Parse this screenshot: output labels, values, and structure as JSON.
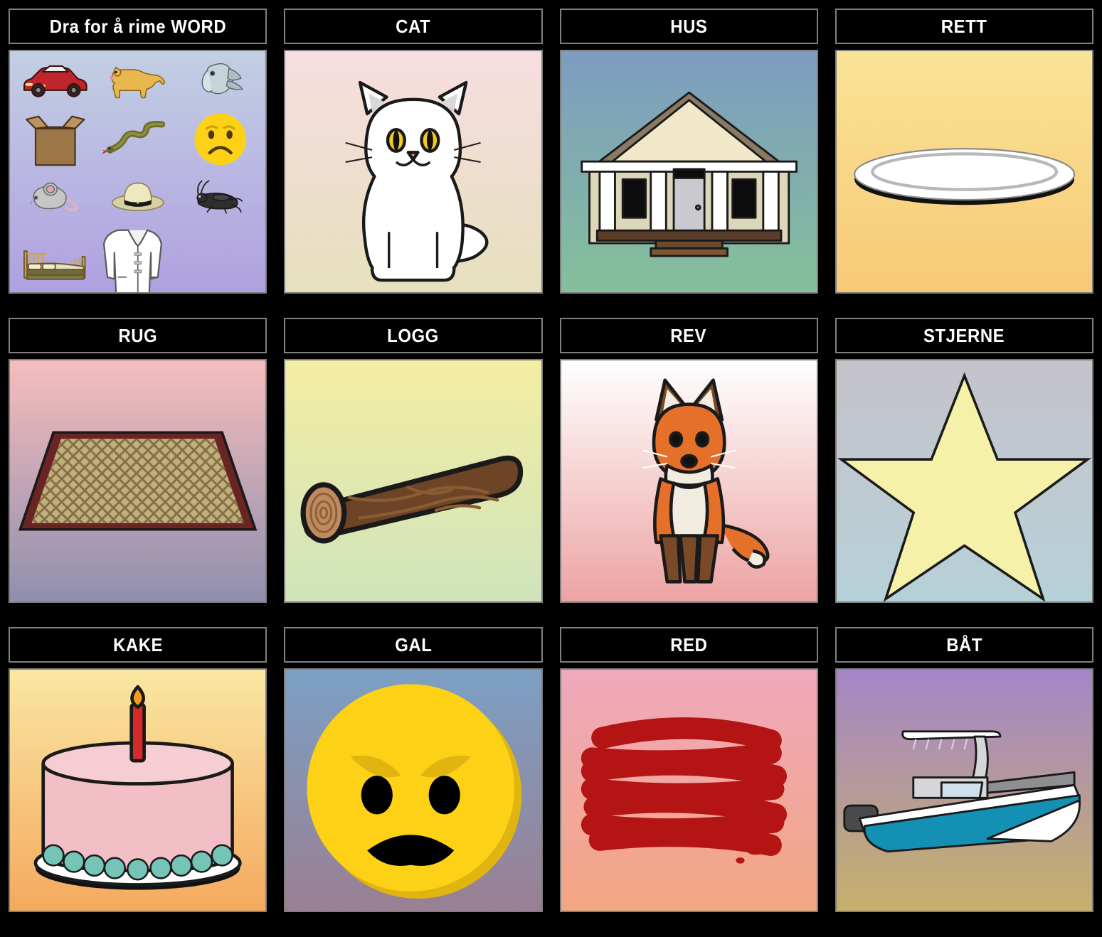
{
  "board": {
    "rows": 3,
    "columns": 4,
    "background_color": "#000000",
    "title_bar_color": "#000000",
    "title_bar_border_color": "#808080",
    "title_text_color": "#ffffff"
  },
  "cells": [
    {
      "id": "cell-prompt",
      "title": "Dra for å rime WORD",
      "kind": "clipart-tray",
      "background": {
        "type": "gradient",
        "from": "#c2cfe3",
        "to": "#b0a0e0"
      },
      "items": [
        {
          "name": "car-clipart",
          "label": "car"
        },
        {
          "name": "dog-clipart",
          "label": "dog"
        },
        {
          "name": "fish-clipart",
          "label": "fish"
        },
        {
          "name": "box-clipart",
          "label": "box"
        },
        {
          "name": "snake-clipart",
          "label": "snake"
        },
        {
          "name": "sad-face-clipart",
          "label": "sad face"
        },
        {
          "name": "mouse-clipart",
          "label": "mouse"
        },
        {
          "name": "hat-clipart",
          "label": "hat"
        },
        {
          "name": "cricket-clipart",
          "label": "cricket"
        },
        {
          "name": "bed-clipart",
          "label": "bed"
        },
        {
          "name": "coat-clipart",
          "label": "coat"
        }
      ]
    },
    {
      "id": "cell-cat",
      "title": "CAT",
      "kind": "illustration",
      "illustration": "white-persian-cat",
      "background": {
        "type": "gradient",
        "from": "#f7dde0",
        "to": "#e6e0bd"
      },
      "colors": {
        "body": "#ffffff",
        "outline": "#1a1a1a",
        "eye": "#f2cc1e",
        "nose": "#d9a0a8",
        "ear_inner": "#d8d8d8"
      }
    },
    {
      "id": "cell-hus",
      "title": "HUS",
      "kind": "illustration",
      "illustration": "house",
      "background": {
        "type": "gradient",
        "from": "#7d9cc0",
        "to": "#84c09a"
      },
      "colors": {
        "siding": "#f0e8c8",
        "wall": "#ddd6b8",
        "roof": "#8a7a63",
        "trim": "#ffffff",
        "door": "#c9c9cf",
        "porch": "#5a3d28",
        "window": "#0c0c0c",
        "outline": "#1a1a1a"
      }
    },
    {
      "id": "cell-rett",
      "title": "RETT",
      "kind": "illustration",
      "illustration": "plate",
      "background": {
        "type": "gradient",
        "from": "#f9e496",
        "to": "#f8c977"
      },
      "colors": {
        "plate": "#ffffff",
        "rim": "#b8b8b8",
        "shadow": "#111111"
      }
    },
    {
      "id": "cell-rug",
      "title": "RUG",
      "kind": "illustration",
      "illustration": "rug",
      "background": {
        "type": "gradient",
        "from": "#f6bdbd",
        "to": "#8f8fae"
      },
      "colors": {
        "field": "#bcb37a",
        "border": "#6b2424",
        "weave": "#8a6a4a",
        "outline": "#1a1a1a"
      }
    },
    {
      "id": "cell-logg",
      "title": "LOGG",
      "kind": "illustration",
      "illustration": "log",
      "background": {
        "type": "gradient",
        "from": "#f4eda2",
        "to": "#cfe4bc"
      },
      "colors": {
        "bark": "#6d4526",
        "bark_light": "#8a5c33",
        "end": "#c08a5e",
        "outline": "#1a1a1a"
      }
    },
    {
      "id": "cell-rev",
      "title": "REV",
      "kind": "illustration",
      "illustration": "fox",
      "background": {
        "type": "gradient",
        "from": "#ffffff",
        "to": "#eda3a3"
      },
      "colors": {
        "fur": "#e4702a",
        "fur_dark": "#7a4a28",
        "belly": "#f2ece0",
        "outline": "#1a1a1a"
      }
    },
    {
      "id": "cell-stjerne",
      "title": "STJERNE",
      "kind": "illustration",
      "illustration": "star",
      "background": {
        "type": "gradient",
        "from": "#c6c2ca",
        "to": "#b6d1d8"
      },
      "colors": {
        "star": "#f6f1a8",
        "outline": "#1a1a1a"
      }
    },
    {
      "id": "cell-kake",
      "title": "KAKE",
      "kind": "illustration",
      "illustration": "birthday-cake",
      "background": {
        "type": "gradient",
        "from": "#f9e7a2",
        "to": "#f5a95f"
      },
      "colors": {
        "frosting": "#f2bfc6",
        "frosting_top": "#f6cdd2",
        "plate": "#ffffff",
        "beads": "#74c4b8",
        "candle": "#d42a2a",
        "flame": "#f79b1f",
        "outline": "#1a1a1a"
      }
    },
    {
      "id": "cell-gal",
      "title": "GAL",
      "kind": "illustration",
      "illustration": "angry-face",
      "background": {
        "type": "gradient",
        "from": "#7ba0c4",
        "to": "#9a7f92"
      },
      "colors": {
        "face": "#fcd116",
        "face_shade": "#e0b510",
        "features": "#000000"
      }
    },
    {
      "id": "cell-red",
      "title": "RED",
      "kind": "illustration",
      "illustration": "red-scribble",
      "background": {
        "type": "gradient",
        "from": "#f0a8bd",
        "to": "#f3a682"
      },
      "colors": {
        "scribble": "#b41414"
      }
    },
    {
      "id": "cell-bat",
      "title": "BÅT",
      "kind": "illustration",
      "illustration": "boat",
      "background": {
        "type": "gradient",
        "from": "#a585c8",
        "to": "#c6b06a"
      },
      "colors": {
        "hull": "#1490b4",
        "deck": "#ffffff",
        "trim": "#d5d5da",
        "motor": "#4a4a4a",
        "outline": "#1a1a1a"
      }
    }
  ]
}
